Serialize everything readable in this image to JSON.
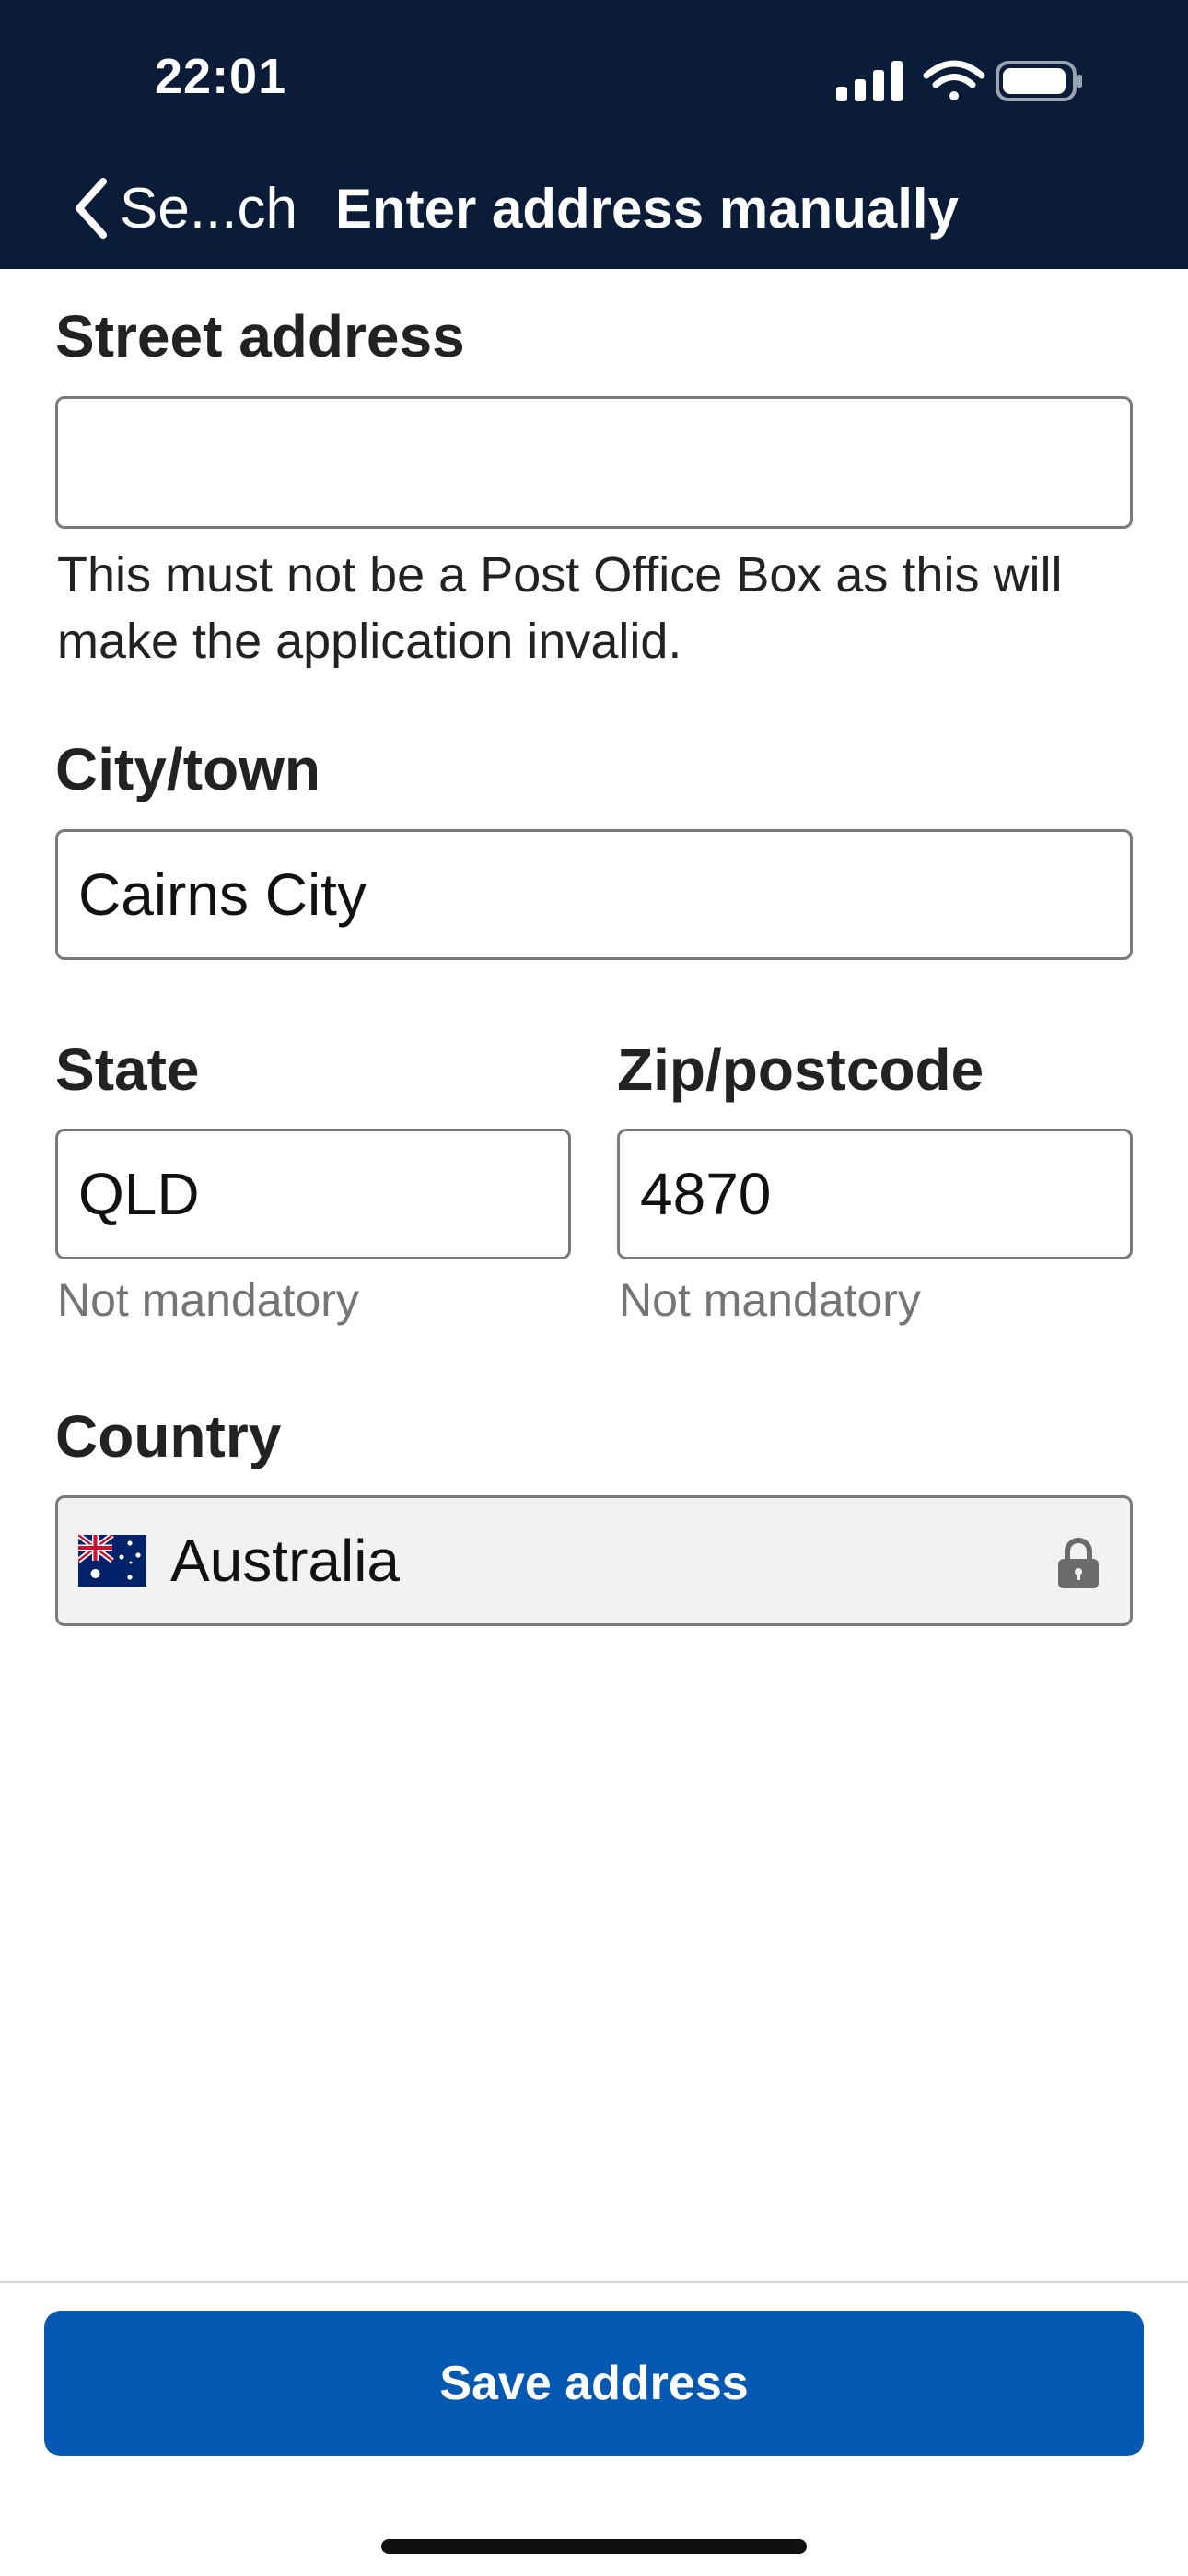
{
  "status_bar": {
    "time": "22:01",
    "icons": [
      "cellular-signal-icon",
      "wifi-icon",
      "battery-icon"
    ]
  },
  "nav": {
    "back_label": "Se...ch",
    "title": "Enter address manually"
  },
  "form": {
    "street": {
      "label": "Street address",
      "value": "",
      "hint": "This must not be a Post Office Box as this will make the application invalid."
    },
    "city": {
      "label": "City/town",
      "value": "Cairns City"
    },
    "state": {
      "label": "State",
      "value": "QLD",
      "sub": "Not mandatory"
    },
    "zip": {
      "label": "Zip/postcode",
      "value": "4870",
      "sub": "Not mandatory"
    },
    "country": {
      "label": "Country",
      "value": "Australia",
      "flag_icon": "australia-flag-icon",
      "lock_icon": "lock-icon"
    }
  },
  "footer": {
    "save_label": "Save address"
  },
  "colors": {
    "header_bg": "#0a1c37",
    "primary_button": "#0559b3",
    "field_border": "#7a7a7a",
    "locked_field_bg": "#f2f2f2",
    "sub_text": "#757575"
  }
}
